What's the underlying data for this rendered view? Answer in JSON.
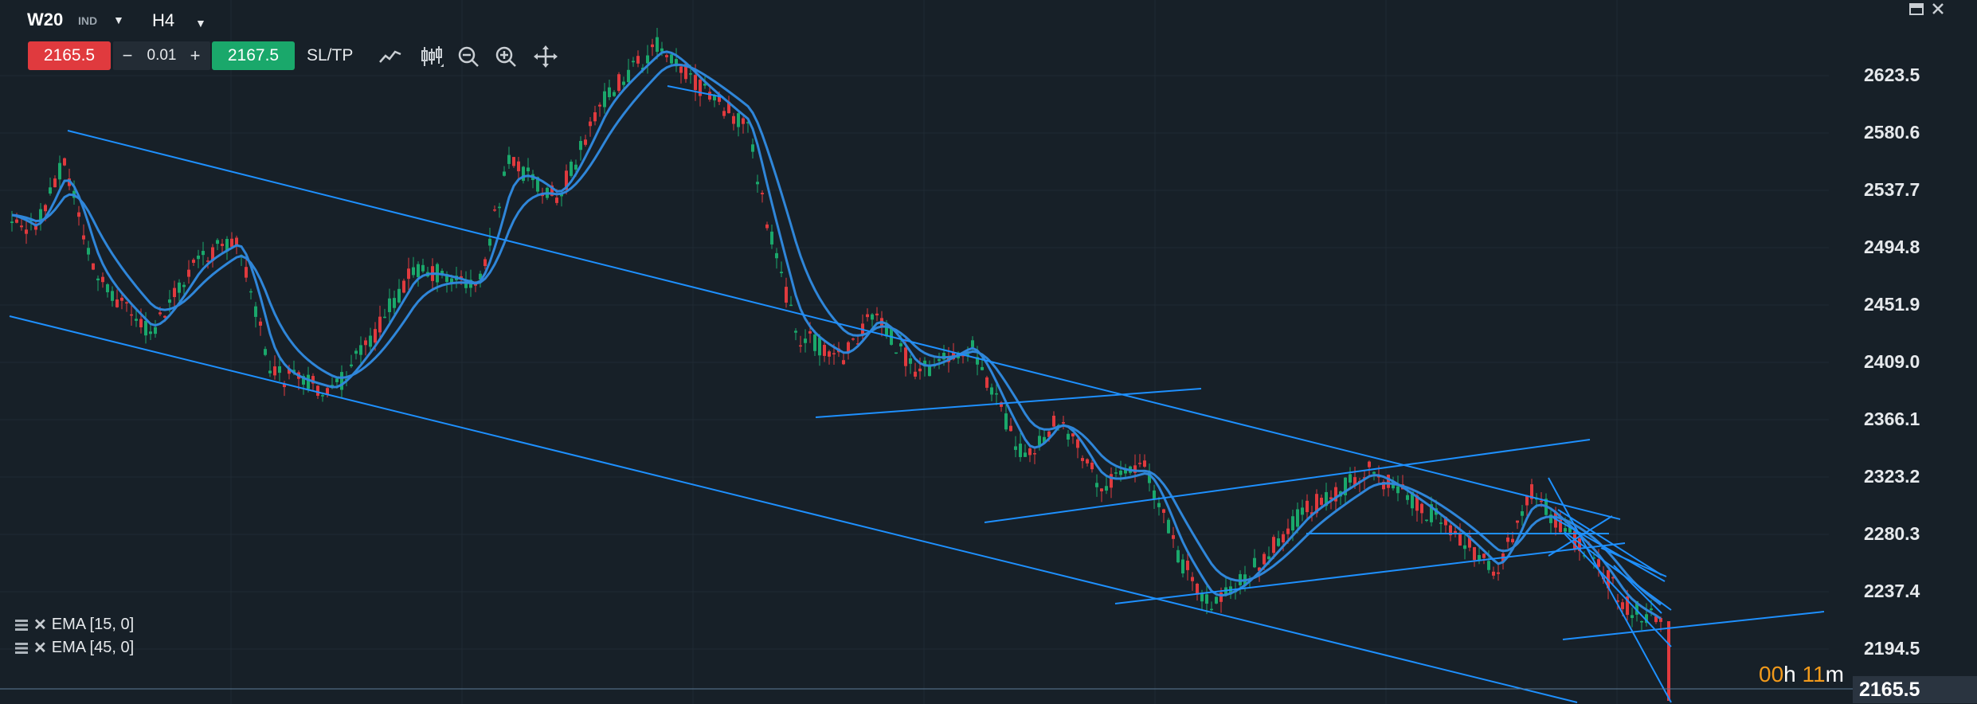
{
  "symbol": {
    "name": "W20",
    "exchange": "IND",
    "timeframe": "H4"
  },
  "trade": {
    "sell_price": "2165.5",
    "buy_price": "2167.5",
    "lot": "0.01",
    "minus": "−",
    "plus": "+",
    "sltp_label": "SL/TP"
  },
  "toolbar_icons": [
    "line-chart-icon",
    "candlestick-icon",
    "zoom-out-icon",
    "zoom-in-icon",
    "crosshair-icon"
  ],
  "window_icons": [
    "minimize-icon",
    "close-icon"
  ],
  "indicators": [
    {
      "label": "EMA [15, 0]"
    },
    {
      "label": "EMA [45, 0]"
    }
  ],
  "price_axis": [
    "2623.5",
    "2580.6",
    "2537.7",
    "2494.8",
    "2451.9",
    "2409.0",
    "2366.1",
    "2323.2",
    "2280.3",
    "2237.4",
    "2194.5"
  ],
  "current_price": "2165.5",
  "countdown": {
    "hh": "00",
    "h_suffix": "h ",
    "mm": "11",
    "m_suffix": "m"
  },
  "colors": {
    "background": "#172028",
    "up": "#1aa86b",
    "down": "#e03a3e",
    "ema": "#2f86d9",
    "trendline": "#1e90ff",
    "sell": "#e03a3e",
    "buy": "#1aa86b",
    "timer": "#f29a1b"
  }
}
